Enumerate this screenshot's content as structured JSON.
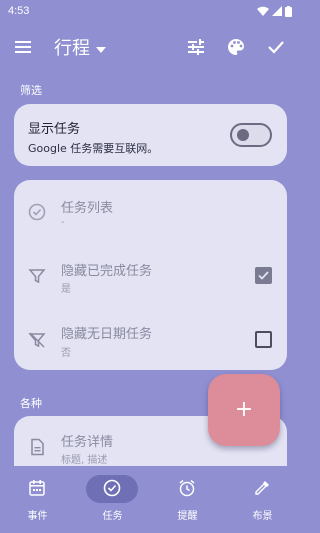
{
  "status_bar": {
    "time": "4:53"
  },
  "app_bar": {
    "title": "行程"
  },
  "sections": {
    "filter_label": "筛选",
    "misc_label": "各种"
  },
  "display_tasks": {
    "title": "显示任务",
    "subtitle": "Google 任务需要互联网。",
    "switch_on": false
  },
  "filters": [
    {
      "label": "任务列表",
      "sub": "-"
    },
    {
      "label": "隐藏已完成任务",
      "sub": "是",
      "checked": true
    },
    {
      "label": "隐藏无日期任务",
      "sub": "否",
      "checked": false
    }
  ],
  "misc": {
    "label": "任务详情",
    "sub": "标题, 描述"
  },
  "fab": {
    "symbol": "+"
  },
  "bottom_nav": [
    {
      "label": "事件",
      "icon": "calendar-icon"
    },
    {
      "label": "任务",
      "icon": "task-check-icon",
      "selected": true
    },
    {
      "label": "提醒",
      "icon": "alarm-icon"
    },
    {
      "label": "布景",
      "icon": "eyedropper-icon"
    }
  ],
  "colors": {
    "background": "#8f8fd2",
    "card": "#e3e3f3",
    "fab": "#dd8c9a",
    "nav_selected_pill": "#6f6fb6"
  }
}
